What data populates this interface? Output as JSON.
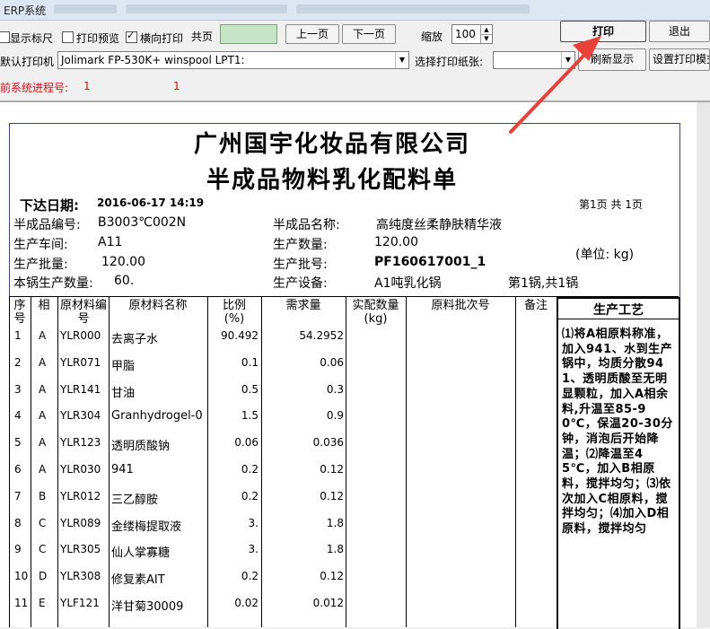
{
  "window": {
    "title": "ERP系统"
  },
  "toolbar": {
    "show_ruler": "显示标尺",
    "print_preview": "打印预览",
    "landscape": "横向打印",
    "total_pages_label": "共页",
    "prev_page": "上一页",
    "next_page": "下一页",
    "zoom_label": "缩放",
    "zoom_value": "100",
    "print_button": "打印",
    "exit_button": "退出",
    "printer_label": "默认打印机",
    "printer_value": "Jolimark FP-530K+ winspool LPT1:",
    "paper_label": "选择打印纸张:",
    "paper_value": "",
    "refresh_button": "刷新显示",
    "print_settings_button": "设置打印模式",
    "process_label": "当前系统进程号:",
    "process_value1": "1",
    "process_value2": "1"
  },
  "document": {
    "company": "广州国宇化妆品有限公司",
    "title": "半成品物料乳化配料单",
    "issue_date_label": "下达日期:",
    "issue_date": "2016-06-17 14:19",
    "page_info": "第1页 共 1页",
    "code_label": "半成品编号:",
    "code": "B3003℃002N",
    "name_label": "半成品名称:",
    "name": "高纯度丝柔静肤精华液",
    "workshop_label": "生产车间:",
    "workshop": "A11",
    "qty_label": "生产数量:",
    "qty": "120.00",
    "unit": "(单位: kg)",
    "batch_qty_label": "生产批量:",
    "batch_qty": "120.00",
    "batch_no_label": "生产批号:",
    "batch_no": "PF160617001_1",
    "pot_qty_label": "本锅生产数量:",
    "pot_qty": "60.",
    "equipment_label": "生产设备:",
    "equipment": "A1吨乳化锅",
    "pot_info": "第1锅,共1锅",
    "headers": {
      "seq": "序号",
      "phase": "相",
      "code": "原材料编号",
      "name": "原材料名称",
      "ratio": "比例(%)",
      "demand": "需求量",
      "actual": "实配数量(kg)",
      "lot": "原料批次号",
      "remark": "备注",
      "process": "生产工艺"
    },
    "rows": [
      {
        "seq": "1",
        "phase": "A",
        "code": "YLR000",
        "name": "去离子水",
        "ratio": "90.492",
        "demand": "54.2952"
      },
      {
        "seq": "2",
        "phase": "A",
        "code": "YLR071",
        "name": "甲脂",
        "ratio": "0.1",
        "demand": "0.06"
      },
      {
        "seq": "3",
        "phase": "A",
        "code": "YLR141",
        "name": "甘油",
        "ratio": "0.5",
        "demand": "0.3"
      },
      {
        "seq": "4",
        "phase": "A",
        "code": "YLR304",
        "name": "Granhydrogel-0",
        "ratio": "1.5",
        "demand": "0.9"
      },
      {
        "seq": "5",
        "phase": "A",
        "code": "YLR123",
        "name": "透明质酸钠",
        "ratio": "0.06",
        "demand": "0.036"
      },
      {
        "seq": "6",
        "phase": "A",
        "code": "YLR030",
        "name": "941",
        "ratio": "0.2",
        "demand": "0.12"
      },
      {
        "seq": "7",
        "phase": "B",
        "code": "YLR012",
        "name": "三乙醇胺",
        "ratio": "0.2",
        "demand": "0.12"
      },
      {
        "seq": "8",
        "phase": "C",
        "code": "YLR089",
        "name": "金缕梅提取液",
        "ratio": "3.",
        "demand": "1.8"
      },
      {
        "seq": "9",
        "phase": "C",
        "code": "YLR305",
        "name": "仙人掌寡糖",
        "ratio": "3.",
        "demand": "1.8"
      },
      {
        "seq": "10",
        "phase": "D",
        "code": "YLR308",
        "name": "修复素AIT",
        "ratio": "0.2",
        "demand": "0.12"
      },
      {
        "seq": "11",
        "phase": "E",
        "code": "YLF121",
        "name": "洋甘菊30009",
        "ratio": "0.02",
        "demand": "0.012"
      }
    ],
    "process_text": "⑴将A相原料称准，加入941、水到生产锅中，均质分散941、透明质酸至无明显颗粒，加入A相余料,升温至85-90℃，保温20-30分钟，消泡后开始降温；⑵降温至45℃，加入B相原料，搅拌均匀；⑶依次加入C相原料，搅拌均匀；⑷加入D相原料，搅拌均匀"
  },
  "colors": {
    "annotation_arrow": "#e8413a",
    "process_red": "#d01010",
    "border_blue": "#3a3ab0"
  }
}
